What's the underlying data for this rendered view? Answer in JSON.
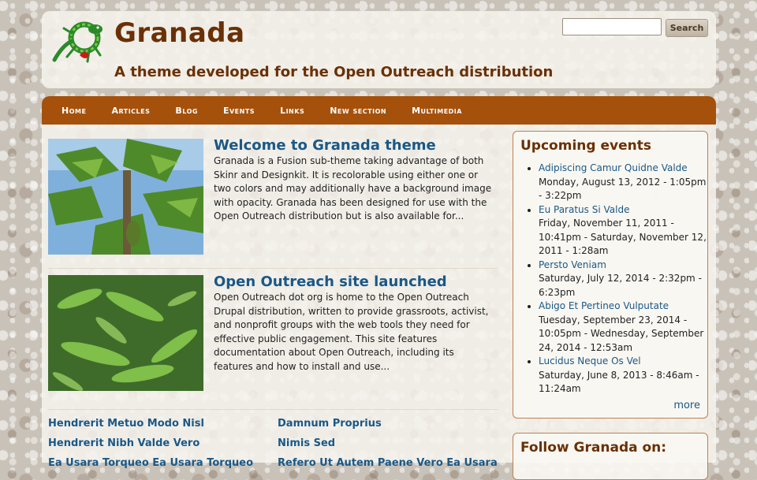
{
  "site": {
    "name": "Granada",
    "slogan": "A theme developed for the Open Outreach distribution"
  },
  "search": {
    "value": "",
    "placeholder": "",
    "button_label": "Search"
  },
  "nav": {
    "items": [
      "Home",
      "Articles",
      "Blog",
      "Events",
      "Links",
      "New section",
      "Multimedia"
    ]
  },
  "teasers": [
    {
      "title": "Welcome to Granada theme",
      "body": "Granada is a Fusion sub-theme taking advantage of both Skinr and  Designkit.  It is recolorable using either one or two colors and may additionally have a background image with opacity.  Granada has been designed for use with the Open Outreach distribution but is also available for..."
    },
    {
      "title": "Open Outreach site launched",
      "body": "Open Outreach dot org is home to the Open Outreach Drupal distribution, written to provide grassroots, activist, and nonprofit groups with the web tools they need for effective public engagement. This site features documentation about Open Outreach, including its features and how to install and use..."
    }
  ],
  "bottom_links": {
    "left": [
      "Hendrerit Metuo Modo Nisl",
      "Hendrerit Nibh Valde Vero",
      "Ea Usara Torqueo Ea Usara Torqueo"
    ],
    "right": [
      "Damnum Proprius",
      "Nimis Sed",
      "Refero Ut Autem Paene Vero Ea Usara"
    ]
  },
  "events_block": {
    "title": "Upcoming events",
    "events": [
      {
        "name": "Adipiscing Camur Quidne Valde",
        "date": "Monday, August 13, 2012 - 1:05pm - 3:22pm"
      },
      {
        "name": "Eu Paratus Si Valde",
        "date": "Friday, November 11, 2011 - 10:41pm - Saturday, November 12, 2011 - 1:28am"
      },
      {
        "name": "Persto Veniam",
        "date": "Saturday, July 12, 2014 - 2:32pm - 6:23pm"
      },
      {
        "name": "Abigo Et Pertineo Vulputate",
        "date": "Tuesday, September 23, 2014 - 10:05pm - Wednesday, September 24, 2014 - 12:53am"
      },
      {
        "name": "Lucidus Neque Os Vel",
        "date": "Saturday, June 8, 2013 - 8:46am - 11:24am"
      }
    ],
    "more_label": "more"
  },
  "follow_block": {
    "title": "Follow Granada on:"
  },
  "colors": {
    "accent": "#a5510c",
    "title_brown": "#6a3006",
    "link_blue": "#1a5887"
  }
}
